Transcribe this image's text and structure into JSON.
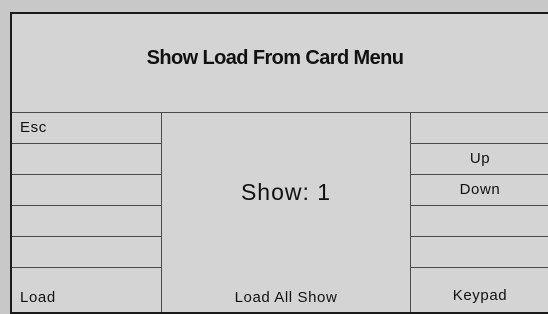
{
  "menu": {
    "title": "Show Load From Card Menu"
  },
  "left_buttons": [
    {
      "label": "Esc"
    },
    {
      "label": ""
    },
    {
      "label": ""
    },
    {
      "label": ""
    },
    {
      "label": ""
    }
  ],
  "right_buttons": [
    {
      "label": ""
    },
    {
      "label": "Up"
    },
    {
      "label": "Down"
    },
    {
      "label": ""
    },
    {
      "label": ""
    }
  ],
  "display": {
    "show_text": "Show: 1"
  },
  "bottom_bar": {
    "left_label": "Load",
    "center_label": "Load  All Show",
    "right_label": "Keypad"
  }
}
